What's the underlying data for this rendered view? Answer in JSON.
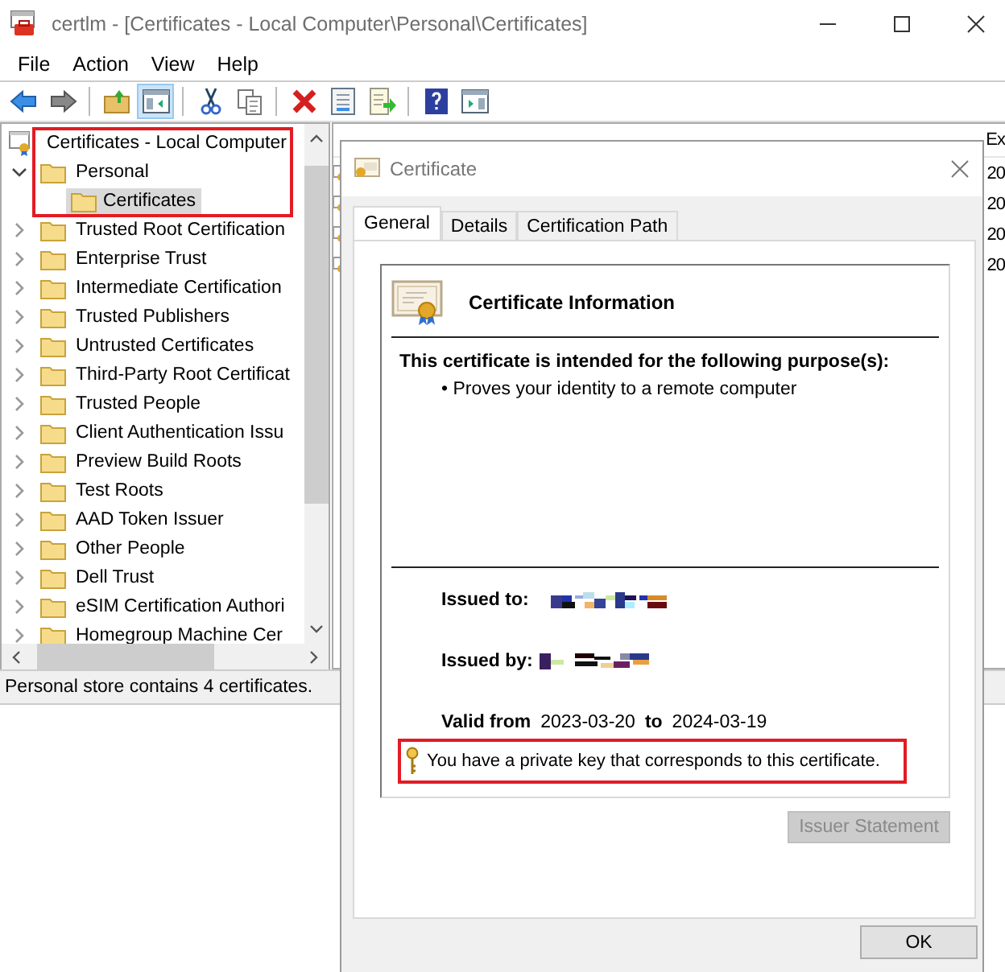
{
  "window": {
    "title": "certlm - [Certificates - Local Computer\\Personal\\Certificates]"
  },
  "menu": [
    "File",
    "Action",
    "View",
    "Help"
  ],
  "toolbar": [
    {
      "kind": "back",
      "selected": false
    },
    {
      "kind": "forward",
      "selected": false
    },
    {
      "kind": "separator"
    },
    {
      "kind": "up",
      "selected": false
    },
    {
      "kind": "console",
      "selected": true
    },
    {
      "kind": "separator"
    },
    {
      "kind": "cut",
      "selected": false
    },
    {
      "kind": "copy",
      "selected": false
    },
    {
      "kind": "separator"
    },
    {
      "kind": "delete",
      "selected": false
    },
    {
      "kind": "properties",
      "selected": false
    },
    {
      "kind": "export",
      "selected": false
    },
    {
      "kind": "separator"
    },
    {
      "kind": "help",
      "selected": false
    },
    {
      "kind": "actionpane",
      "selected": false
    }
  ],
  "tree": {
    "highlighted": true,
    "root": {
      "label": "Certificates - Local Computer",
      "children": [
        {
          "label": "Personal",
          "expanded": true,
          "selected": false,
          "children": [
            {
              "label": "Certificates",
              "selected": true
            }
          ]
        },
        {
          "label": "Trusted Root Certification",
          "expanded": false,
          "selected": false
        },
        {
          "label": "Enterprise Trust",
          "expanded": false,
          "selected": false
        },
        {
          "label": "Intermediate Certification",
          "expanded": false,
          "selected": false
        },
        {
          "label": "Trusted Publishers",
          "expanded": false,
          "selected": false
        },
        {
          "label": "Untrusted Certificates",
          "expanded": false,
          "selected": false
        },
        {
          "label": "Third-Party Root Certificat",
          "expanded": false,
          "selected": false
        },
        {
          "label": "Trusted People",
          "expanded": false,
          "selected": false
        },
        {
          "label": "Client Authentication Issu",
          "expanded": false,
          "selected": false
        },
        {
          "label": "Preview Build Roots",
          "expanded": false,
          "selected": false
        },
        {
          "label": "Test Roots",
          "expanded": false,
          "selected": false
        },
        {
          "label": "AAD Token Issuer",
          "expanded": false,
          "selected": false
        },
        {
          "label": "Other People",
          "expanded": false,
          "selected": false
        },
        {
          "label": "Dell Trust",
          "expanded": false,
          "selected": false
        },
        {
          "label": "eSIM Certification Authori",
          "expanded": false,
          "selected": false
        },
        {
          "label": "Homegroup Machine Cer",
          "expanded": false,
          "selected": false
        }
      ]
    }
  },
  "list_pane": {
    "columns": [
      "Ex"
    ],
    "rows": [
      [
        "20"
      ],
      [
        "20"
      ],
      [
        "20"
      ],
      [
        "20"
      ]
    ]
  },
  "status_bar": "Personal store contains 4 certificates.",
  "dialog": {
    "title": "Certificate",
    "tabs": [
      {
        "label": "General",
        "selected": true
      },
      {
        "label": "Details",
        "selected": false
      },
      {
        "label": "Certification Path",
        "selected": false
      }
    ],
    "heading": "Certificate Information",
    "purpose_title": "This certificate is intended for the following purpose(s):",
    "purposes": [
      "• Proves your identity to a remote computer"
    ],
    "issued_to_label": "Issued to:",
    "issued_by_label": "Issued by:",
    "valid_from_label": "Valid from",
    "valid_from": "2023-03-20",
    "valid_to_label": "to",
    "valid_to": "2024-03-19",
    "private_key": {
      "text": "You have a private key that corresponds to this certificate.",
      "highlighted": true
    },
    "buttons": [
      {
        "label": "Issuer Statement",
        "disabled": true
      },
      {
        "label": "OK",
        "disabled": false
      }
    ]
  }
}
